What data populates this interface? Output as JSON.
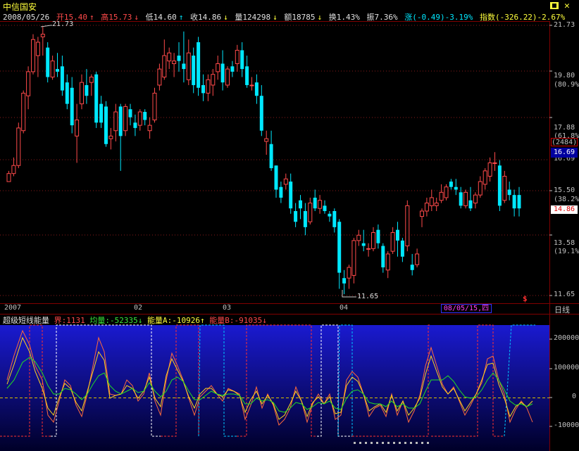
{
  "header": {
    "stock_name": "中信国安",
    "close_icon": "close-x-icon"
  },
  "info": {
    "date": "2008/05/26",
    "open": "开15.40",
    "high": "高15.73",
    "low": "低14.60",
    "close": "收14.86",
    "volume": "量124298",
    "amount": "额18785",
    "turnover": "换1.43%",
    "amplitude": "振7.36%",
    "change": "涨(-0.49)-3.19%",
    "index": "指数(-326.22)-2.67%"
  },
  "price_axis": {
    "labels": [
      "21.73",
      "19.80",
      "(80.9%)",
      "17.88",
      "(61.8%)",
      "15.50",
      "(38.2%)",
      "13.58",
      "(19.1%)",
      "11.65"
    ],
    "count_box": "(2484)",
    "price_box": "16.69",
    "close_box": "14.86",
    "hidden_label": "16.69"
  },
  "annotations": {
    "high_mark": "21.73",
    "low_mark": "11.65",
    "dollar": "$"
  },
  "date_axis": {
    "labels": [
      "2007",
      "02",
      "03",
      "04"
    ],
    "cursor_date": "08/05/15,四",
    "period": "日线"
  },
  "indicator": {
    "name": "超级短线能量",
    "bound": "界:1131",
    "avg": "均量:-52335",
    "energy_a": "能量A:-10926",
    "energy_b": "能量B:-91035",
    "axis": [
      "200000",
      "100000",
      "0",
      "-100000"
    ]
  },
  "colors": {
    "up": "#ff4a4a",
    "down": "#00e8ff",
    "bg": "#000000",
    "panel_grad_top": "#1a1ad0",
    "panel_grad_bottom": "#000020"
  },
  "candles": [
    [
      15.9,
      16.3,
      15.9,
      16.2
    ],
    [
      16.2,
      16.8,
      16.1,
      16.5
    ],
    [
      16.5,
      18.1,
      16.4,
      17.9
    ],
    [
      17.8,
      19.3,
      17.7,
      19.2
    ],
    [
      19.1,
      20.2,
      18.6,
      20.0
    ],
    [
      20.0,
      21.4,
      19.9,
      21.2
    ],
    [
      20.6,
      21.3,
      19.8,
      21.1
    ],
    [
      21.3,
      21.7,
      20.6,
      21.4
    ],
    [
      20.9,
      21.1,
      19.6,
      19.8
    ],
    [
      19.8,
      20.6,
      19.7,
      20.4
    ],
    [
      20.1,
      20.7,
      19.8,
      20.0
    ],
    [
      20.2,
      20.6,
      19.1,
      19.3
    ],
    [
      19.6,
      19.9,
      18.6,
      18.8
    ],
    [
      19.4,
      19.8,
      17.7,
      18.0
    ],
    [
      17.6,
      18.8,
      16.6,
      18.2
    ],
    [
      18.8,
      19.9,
      18.6,
      19.6
    ],
    [
      19.5,
      20.1,
      18.8,
      19.1
    ],
    [
      19.6,
      19.9,
      19.1,
      19.8
    ],
    [
      19.9,
      20.0,
      17.9,
      18.1
    ],
    [
      18.8,
      19.1,
      17.9,
      18.1
    ],
    [
      18.7,
      18.9,
      17.2,
      17.3
    ],
    [
      17.5,
      17.9,
      17.1,
      17.6
    ],
    [
      17.8,
      18.8,
      17.4,
      18.5
    ],
    [
      18.7,
      18.8,
      16.3,
      17.6
    ],
    [
      17.8,
      18.8,
      17.6,
      18.7
    ],
    [
      18.6,
      18.8,
      18.0,
      18.3
    ],
    [
      18.1,
      18.4,
      17.6,
      17.9
    ],
    [
      18.0,
      18.6,
      17.8,
      18.5
    ],
    [
      18.5,
      18.6,
      18.0,
      18.2
    ],
    [
      17.8,
      18.3,
      17.5,
      18.0
    ],
    [
      18.2,
      19.4,
      18.1,
      19.2
    ],
    [
      19.5,
      20.3,
      19.3,
      20.1
    ],
    [
      19.8,
      21.2,
      19.7,
      20.6
    ],
    [
      20.4,
      20.9,
      20.1,
      20.7
    ],
    [
      20.3,
      20.7,
      19.8,
      20.4
    ],
    [
      20.6,
      21.1,
      20.0,
      20.4
    ],
    [
      20.3,
      21.5,
      19.6,
      20.1
    ],
    [
      19.7,
      21.2,
      19.5,
      20.7
    ],
    [
      20.6,
      20.9,
      19.2,
      19.5
    ],
    [
      21.1,
      21.3,
      19.1,
      19.4
    ],
    [
      19.5,
      19.9,
      18.9,
      19.2
    ],
    [
      19.2,
      19.9,
      18.9,
      19.7
    ],
    [
      19.5,
      20.1,
      19.1,
      19.9
    ],
    [
      20.0,
      20.6,
      19.7,
      20.3
    ],
    [
      20.3,
      20.8,
      19.3,
      19.6
    ],
    [
      19.5,
      20.2,
      19.4,
      20.1
    ],
    [
      20.2,
      20.4,
      19.8,
      20.0
    ],
    [
      20.3,
      21.0,
      20.0,
      20.8
    ],
    [
      20.8,
      21.1,
      19.8,
      20.1
    ],
    [
      20.2,
      20.6,
      19.4,
      19.5
    ],
    [
      19.5,
      19.8,
      19.3,
      19.5
    ],
    [
      19.6,
      19.9,
      18.8,
      19.1
    ],
    [
      19.1,
      19.5,
      17.6,
      17.8
    ],
    [
      17.4,
      17.8,
      16.9,
      17.5
    ],
    [
      17.3,
      17.8,
      16.3,
      16.4
    ],
    [
      16.5,
      16.5,
      15.3,
      15.6
    ],
    [
      15.7,
      15.9,
      15.1,
      15.3
    ],
    [
      15.8,
      16.2,
      15.6,
      16.0
    ],
    [
      15.9,
      16.2,
      14.7,
      14.9
    ],
    [
      14.8,
      15.1,
      14.2,
      14.4
    ],
    [
      15.2,
      15.4,
      14.5,
      14.9
    ],
    [
      14.8,
      15.1,
      13.9,
      14.2
    ],
    [
      14.4,
      15.3,
      14.3,
      15.1
    ],
    [
      15.3,
      15.6,
      14.8,
      14.9
    ],
    [
      14.9,
      15.4,
      14.7,
      15.2
    ],
    [
      15.0,
      15.2,
      14.7,
      14.8
    ],
    [
      14.7,
      14.8,
      14.4,
      14.6
    ],
    [
      14.8,
      14.9,
      14.0,
      14.2
    ],
    [
      14.4,
      14.5,
      11.9,
      12.5
    ],
    [
      12.3,
      12.6,
      11.7,
      12.1
    ],
    [
      12.3,
      12.8,
      11.9,
      12.7
    ],
    [
      12.4,
      13.8,
      12.1,
      13.7
    ],
    [
      13.7,
      14.1,
      13.5,
      13.9
    ],
    [
      13.6,
      14.1,
      13.3,
      13.5
    ],
    [
      13.4,
      13.6,
      13.1,
      13.4
    ],
    [
      13.4,
      14.2,
      13.3,
      14.0
    ],
    [
      14.1,
      14.3,
      13.4,
      13.6
    ],
    [
      13.5,
      13.6,
      12.5,
      12.7
    ],
    [
      12.6,
      13.3,
      12.3,
      13.2
    ],
    [
      13.3,
      14.2,
      13.2,
      14.0
    ],
    [
      14.1,
      14.4,
      13.1,
      13.7
    ],
    [
      13.7,
      13.8,
      12.9,
      13.1
    ],
    [
      13.5,
      15.2,
      13.3,
      15.0
    ],
    [
      12.8,
      13.2,
      12.4,
      12.6
    ],
    [
      12.8,
      13.4,
      12.7,
      13.2
    ],
    [
      14.6,
      14.9,
      14.2,
      14.8
    ],
    [
      14.8,
      15.3,
      14.6,
      15.1
    ],
    [
      15.0,
      15.6,
      14.8,
      15.3
    ],
    [
      15.0,
      15.3,
      14.8,
      15.1
    ],
    [
      15.2,
      15.8,
      15.1,
      15.5
    ],
    [
      15.3,
      15.8,
      15.2,
      15.7
    ],
    [
      15.9,
      16.0,
      15.6,
      15.7
    ],
    [
      15.7,
      16.0,
      15.4,
      15.6
    ],
    [
      15.5,
      15.7,
      14.9,
      15.0
    ],
    [
      15.0,
      15.6,
      14.9,
      15.5
    ],
    [
      15.2,
      15.7,
      14.8,
      14.9
    ],
    [
      15.1,
      15.5,
      14.9,
      15.4
    ],
    [
      15.4,
      16.1,
      15.3,
      15.9
    ],
    [
      15.8,
      16.4,
      15.6,
      16.3
    ],
    [
      16.1,
      16.8,
      15.9,
      16.6
    ],
    [
      16.6,
      17.0,
      16.3,
      16.6
    ],
    [
      16.5,
      16.7,
      14.8,
      15.0
    ],
    [
      15.2,
      16.3,
      15.1,
      16.1
    ],
    [
      15.6,
      15.9,
      15.2,
      15.4
    ],
    [
      15.4,
      15.6,
      14.6,
      14.9
    ],
    [
      15.4,
      15.7,
      14.6,
      14.9
    ]
  ]
}
